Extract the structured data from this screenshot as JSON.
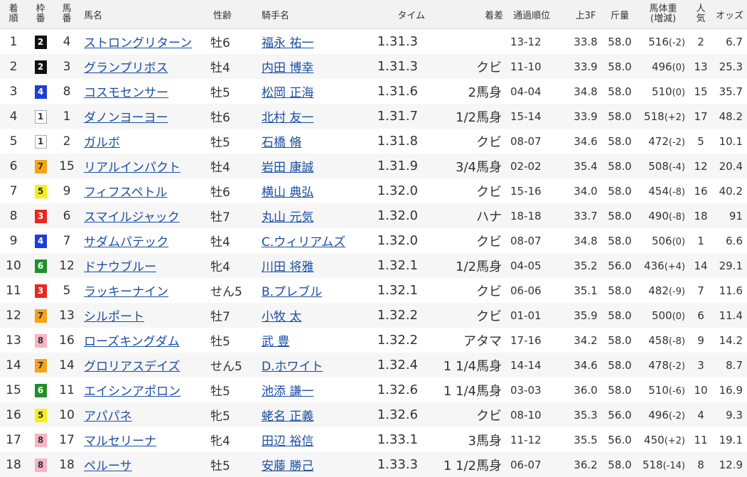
{
  "columns": {
    "finish_a": "着",
    "finish_b": "順",
    "gate_a": "枠",
    "gate_b": "番",
    "horse_no_a": "馬",
    "horse_no_b": "番",
    "horse": "馬名",
    "sex_age": "性齢",
    "jockey": "騎手名",
    "time": "タイム",
    "margin": "着差",
    "passing": "通過順位",
    "last3f": "上3F",
    "load": "斤量",
    "weight_a": "馬体重",
    "weight_b": "(増減)",
    "pop_a": "人",
    "pop_b": "気",
    "odds": "オッズ"
  },
  "gate_colors": {
    "1": "#ffffff",
    "2": "#111111",
    "3": "#e8281e",
    "4": "#1b3fd6",
    "5": "#f7ee1a",
    "6": "#218f2b",
    "7": "#f5a317",
    "8": "#f7b4c6"
  },
  "rows": [
    {
      "finish": "1",
      "gate": "2",
      "num": "4",
      "horse": "ストロングリターン",
      "sex_age": "牡6",
      "jockey": "福永 祐一",
      "time": "1.31.3",
      "margin": "",
      "passing": "13-12",
      "last3f": "33.8",
      "load": "58.0",
      "weight": "516",
      "diff": "(-2)",
      "pop": "2",
      "odds": "6.7"
    },
    {
      "finish": "2",
      "gate": "2",
      "num": "3",
      "horse": "グランプリボス",
      "sex_age": "牡4",
      "jockey": "内田 博幸",
      "time": "1.31.3",
      "margin": "クビ",
      "passing": "11-10",
      "last3f": "33.9",
      "load": "58.0",
      "weight": "496",
      "diff": "(0)",
      "pop": "13",
      "odds": "25.3"
    },
    {
      "finish": "3",
      "gate": "4",
      "num": "8",
      "horse": "コスモセンサー",
      "sex_age": "牡5",
      "jockey": "松岡 正海",
      "time": "1.31.6",
      "margin": "2馬身",
      "passing": "04-04",
      "last3f": "34.8",
      "load": "58.0",
      "weight": "510",
      "diff": "(0)",
      "pop": "15",
      "odds": "35.7"
    },
    {
      "finish": "4",
      "gate": "1",
      "num": "1",
      "horse": "ダノンヨーヨー",
      "sex_age": "牡6",
      "jockey": "北村 友一",
      "time": "1.31.7",
      "margin": "1/2馬身",
      "passing": "15-14",
      "last3f": "33.9",
      "load": "58.0",
      "weight": "518",
      "diff": "(+2)",
      "pop": "17",
      "odds": "48.2"
    },
    {
      "finish": "5",
      "gate": "1",
      "num": "2",
      "horse": "ガルボ",
      "sex_age": "牡5",
      "jockey": "石橋 脩",
      "time": "1.31.8",
      "margin": "クビ",
      "passing": "08-07",
      "last3f": "34.6",
      "load": "58.0",
      "weight": "472",
      "diff": "(-2)",
      "pop": "5",
      "odds": "10.1"
    },
    {
      "finish": "6",
      "gate": "7",
      "num": "15",
      "horse": "リアルインパクト",
      "sex_age": "牡4",
      "jockey": "岩田 康誠",
      "time": "1.31.9",
      "margin": "3/4馬身",
      "passing": "02-02",
      "last3f": "35.4",
      "load": "58.0",
      "weight": "508",
      "diff": "(-4)",
      "pop": "12",
      "odds": "20.4"
    },
    {
      "finish": "7",
      "gate": "5",
      "num": "9",
      "horse": "フィフスペトル",
      "sex_age": "牡6",
      "jockey": "横山 典弘",
      "time": "1.32.0",
      "margin": "クビ",
      "passing": "15-16",
      "last3f": "34.0",
      "load": "58.0",
      "weight": "454",
      "diff": "(-8)",
      "pop": "16",
      "odds": "40.2"
    },
    {
      "finish": "8",
      "gate": "3",
      "num": "6",
      "horse": "スマイルジャック",
      "sex_age": "牡7",
      "jockey": "丸山 元気",
      "time": "1.32.0",
      "margin": "ハナ",
      "passing": "18-18",
      "last3f": "33.7",
      "load": "58.0",
      "weight": "490",
      "diff": "(-8)",
      "pop": "18",
      "odds": "91"
    },
    {
      "finish": "9",
      "gate": "4",
      "num": "7",
      "horse": "サダムパテック",
      "sex_age": "牡4",
      "jockey": "C.ウィリアムズ",
      "time": "1.32.0",
      "margin": "クビ",
      "passing": "08-07",
      "last3f": "34.8",
      "load": "58.0",
      "weight": "506",
      "diff": "(0)",
      "pop": "1",
      "odds": "6.6"
    },
    {
      "finish": "10",
      "gate": "6",
      "num": "12",
      "horse": "ドナウブルー",
      "sex_age": "牝4",
      "jockey": "川田 将雅",
      "time": "1.32.1",
      "margin": "1/2馬身",
      "passing": "04-05",
      "last3f": "35.2",
      "load": "56.0",
      "weight": "436",
      "diff": "(+4)",
      "pop": "14",
      "odds": "29.1"
    },
    {
      "finish": "11",
      "gate": "3",
      "num": "5",
      "horse": "ラッキーナイン",
      "sex_age": "せん5",
      "jockey": "B.プレブル",
      "time": "1.32.1",
      "margin": "クビ",
      "passing": "06-06",
      "last3f": "35.1",
      "load": "58.0",
      "weight": "482",
      "diff": "(-9)",
      "pop": "7",
      "odds": "11.6"
    },
    {
      "finish": "12",
      "gate": "7",
      "num": "13",
      "horse": "シルポート",
      "sex_age": "牡7",
      "jockey": "小牧 太",
      "time": "1.32.2",
      "margin": "クビ",
      "passing": "01-01",
      "last3f": "35.9",
      "load": "58.0",
      "weight": "500",
      "diff": "(0)",
      "pop": "6",
      "odds": "11.4"
    },
    {
      "finish": "13",
      "gate": "8",
      "num": "16",
      "horse": "ローズキングダム",
      "sex_age": "牡5",
      "jockey": "武 豊",
      "time": "1.32.2",
      "margin": "アタマ",
      "passing": "17-16",
      "last3f": "34.2",
      "load": "58.0",
      "weight": "458",
      "diff": "(-8)",
      "pop": "9",
      "odds": "14.2"
    },
    {
      "finish": "14",
      "gate": "7",
      "num": "14",
      "horse": "グロリアスデイズ",
      "sex_age": "せん5",
      "jockey": "D.ホワイト",
      "time": "1.32.4",
      "margin": "1 1/4馬身",
      "passing": "14-14",
      "last3f": "34.6",
      "load": "58.0",
      "weight": "478",
      "diff": "(-2)",
      "pop": "3",
      "odds": "8.7"
    },
    {
      "finish": "15",
      "gate": "6",
      "num": "11",
      "horse": "エイシンアポロン",
      "sex_age": "牡5",
      "jockey": "池添 謙一",
      "time": "1.32.6",
      "margin": "1 1/4馬身",
      "passing": "03-03",
      "last3f": "36.0",
      "load": "58.0",
      "weight": "510",
      "diff": "(-6)",
      "pop": "10",
      "odds": "16.9"
    },
    {
      "finish": "16",
      "gate": "5",
      "num": "10",
      "horse": "アパパネ",
      "sex_age": "牝5",
      "jockey": "蛯名 正義",
      "time": "1.32.6",
      "margin": "クビ",
      "passing": "08-10",
      "last3f": "35.3",
      "load": "56.0",
      "weight": "496",
      "diff": "(-2)",
      "pop": "4",
      "odds": "9.3"
    },
    {
      "finish": "17",
      "gate": "8",
      "num": "17",
      "horse": "マルセリーナ",
      "sex_age": "牝4",
      "jockey": "田辺 裕信",
      "time": "1.33.1",
      "margin": "3馬身",
      "passing": "11-12",
      "last3f": "35.5",
      "load": "56.0",
      "weight": "450",
      "diff": "(+2)",
      "pop": "11",
      "odds": "19.1"
    },
    {
      "finish": "18",
      "gate": "8",
      "num": "18",
      "horse": "ペルーサ",
      "sex_age": "牡5",
      "jockey": "安藤 勝己",
      "time": "1.33.3",
      "margin": "1 1/2馬身",
      "passing": "06-07",
      "last3f": "36.2",
      "load": "58.0",
      "weight": "518",
      "diff": "(-14)",
      "pop": "8",
      "odds": "12.9"
    }
  ]
}
